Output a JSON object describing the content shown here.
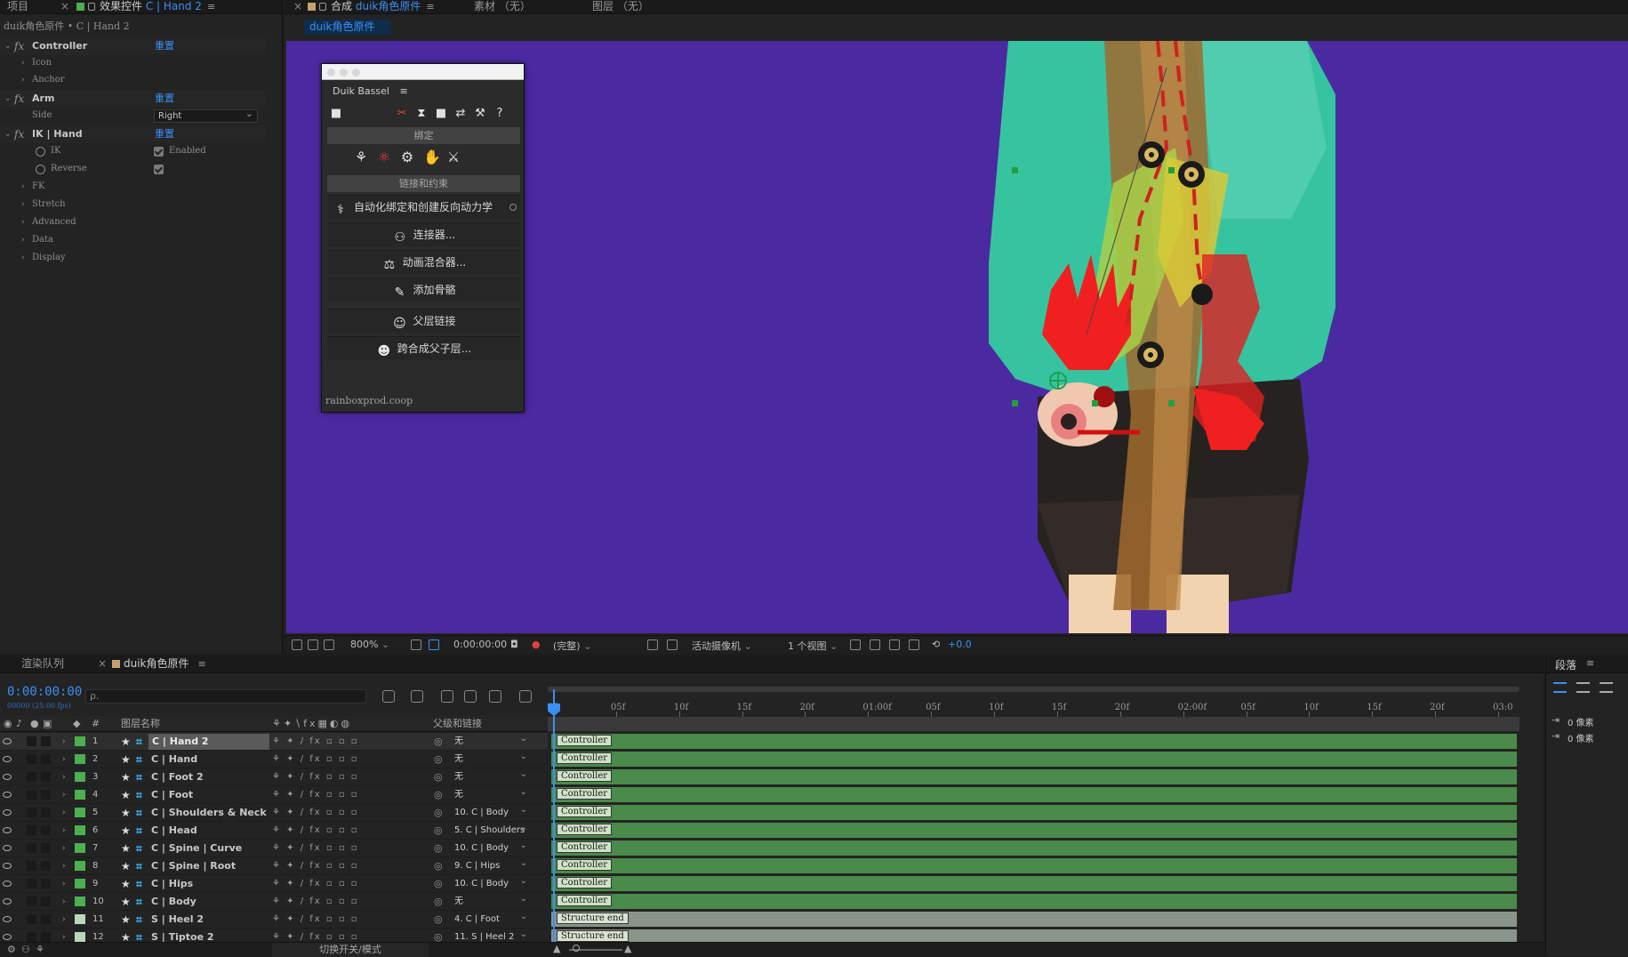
{
  "effects_panel": {
    "tabs": [
      {
        "label": "项目"
      },
      {
        "label_prefix": "效果控件",
        "label_highlight": "C | Hand 2"
      }
    ],
    "breadcrumb": "duik角色原件 • C | Hand 2",
    "groups": [
      {
        "fx": "fx",
        "name": "Controller",
        "reset": "重置",
        "children": [
          "Icon",
          "Anchor"
        ]
      },
      {
        "fx": "fx",
        "name": "Arm",
        "reset": "重置",
        "side_label": "Side",
        "side_value": "Right"
      },
      {
        "fx": "fx",
        "name": "IK | Hand",
        "reset": "重置",
        "ik_label": "IK",
        "ik_checkbox_label": "Enabled",
        "reverse_label": "Reverse",
        "children": [
          "FK",
          "Stretch",
          "Advanced",
          "Data",
          "Display"
        ]
      }
    ]
  },
  "viewer": {
    "tabs": [
      {
        "label_prefix": "合成",
        "label_highlight": "duik角色原件"
      },
      {
        "label": "素材 （无）"
      },
      {
        "label": "图层 （无）"
      }
    ],
    "subtab": "duik角色原件",
    "bottom_bar": {
      "zoom": "800%",
      "timecode": "0:00:00:00",
      "resolution": "(完整)",
      "camera": "活动摄像机",
      "views": "1 个视图",
      "exposure": "+0.0"
    }
  },
  "duik": {
    "title": "Duik Bassel",
    "menu": "≡",
    "section_rig": "绑定",
    "section_links": "链接和约束",
    "auto_rig": "自动化绑定和创建反向动力学",
    "buttons": [
      "连接器...",
      "动画混合器...",
      "添加骨骼",
      "父层链接",
      "跨合成父子层..."
    ],
    "footer": "rainboxprod.coop",
    "toolbar_icons": [
      "panel-icon",
      "rig-icon",
      "hourglass-icon",
      "camera-icon",
      "swap-icon",
      "wrench-icon",
      "help-icon"
    ],
    "rig_icons": [
      "bone-links-icon",
      "structure-icon",
      "gear-icon",
      "hand-icon",
      "hand-pose-icon"
    ]
  },
  "timeline": {
    "tabs": [
      {
        "label": "渲染队列"
      },
      {
        "label": "duik角色原件"
      }
    ],
    "time": "0:00:00:00",
    "fps": "00000 (25.00 fps)",
    "search_placeholder": "ρ.",
    "col_hash": "#",
    "col_name": "图层名称",
    "col_parent": "父级和链接",
    "ruler": [
      "0f",
      "05f",
      "10f",
      "15f",
      "20f",
      "01:00f",
      "05f",
      "10f",
      "15f",
      "20f",
      "02:00f",
      "05f",
      "10f",
      "15f",
      "20f",
      "03:0"
    ],
    "bottom_toggle": "切换开关/模式",
    "layers": [
      {
        "num": "1",
        "name": "C | Hand 2",
        "parent": "无",
        "bar": "Controller",
        "color": "#4caf50"
      },
      {
        "num": "2",
        "name": "C | Hand",
        "parent": "无",
        "bar": "Controller",
        "color": "#4caf50"
      },
      {
        "num": "3",
        "name": "C | Foot 2",
        "parent": "无",
        "bar": "Controller",
        "color": "#4caf50"
      },
      {
        "num": "4",
        "name": "C | Foot",
        "parent": "无",
        "bar": "Controller",
        "color": "#4caf50"
      },
      {
        "num": "5",
        "name": "C | Shoulders & Neck",
        "parent": "10. C | Body",
        "bar": "Controller",
        "color": "#4caf50"
      },
      {
        "num": "6",
        "name": "C | Head",
        "parent": "5. C | Shoulders",
        "bar": "Controller",
        "color": "#4caf50"
      },
      {
        "num": "7",
        "name": "C | Spine | Curve",
        "parent": "10. C | Body",
        "bar": "Controller",
        "color": "#4caf50"
      },
      {
        "num": "8",
        "name": "C | Spine | Root",
        "parent": "9. C | Hips",
        "bar": "Controller",
        "color": "#4caf50"
      },
      {
        "num": "9",
        "name": "C | Hips",
        "parent": "10. C | Body",
        "bar": "Controller",
        "color": "#4caf50"
      },
      {
        "num": "10",
        "name": "C | Body",
        "parent": "无",
        "bar": "Controller",
        "color": "#4caf50"
      },
      {
        "num": "11",
        "name": "S | Heel 2",
        "parent": "4. C | Foot",
        "bar": "Structure end",
        "color": "#b8d8b8"
      },
      {
        "num": "12",
        "name": "S | Tiptoe 2",
        "parent": "11. S | Heel 2",
        "bar": "Structure end",
        "color": "#b8d8b8"
      }
    ]
  },
  "paragraph_panel": {
    "title": "段落",
    "indent_1": "0 像素",
    "indent_2": "0 像素"
  }
}
